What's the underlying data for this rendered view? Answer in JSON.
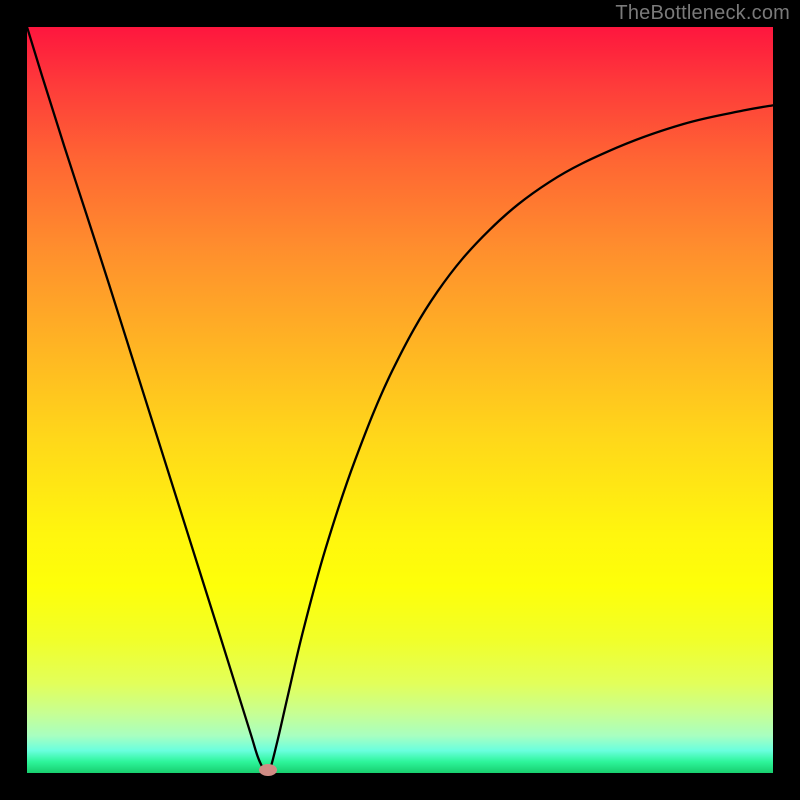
{
  "watermark": "TheBottleneck.com",
  "chart_data": {
    "type": "line",
    "title": "",
    "xlabel": "",
    "ylabel": "",
    "xlim": [
      0,
      1
    ],
    "ylim": [
      0,
      1
    ],
    "series": [
      {
        "name": "bottleneck-curve",
        "x": [
          0.0,
          0.02,
          0.05,
          0.08,
          0.11,
          0.14,
          0.17,
          0.2,
          0.23,
          0.26,
          0.28,
          0.3,
          0.31,
          0.319,
          0.325,
          0.335,
          0.35,
          0.37,
          0.4,
          0.44,
          0.49,
          0.55,
          0.62,
          0.7,
          0.79,
          0.88,
          0.96,
          1.0
        ],
        "y": [
          1.0,
          0.935,
          0.84,
          0.748,
          0.655,
          0.56,
          0.465,
          0.37,
          0.275,
          0.18,
          0.116,
          0.052,
          0.02,
          0.003,
          0.003,
          0.04,
          0.105,
          0.19,
          0.3,
          0.42,
          0.54,
          0.645,
          0.728,
          0.792,
          0.838,
          0.87,
          0.888,
          0.895
        ]
      }
    ],
    "marker": {
      "x": 0.323,
      "y": 0.0
    },
    "background_gradient": {
      "top_color": "#fe163e",
      "bottom_color": "#18ce6e"
    }
  }
}
